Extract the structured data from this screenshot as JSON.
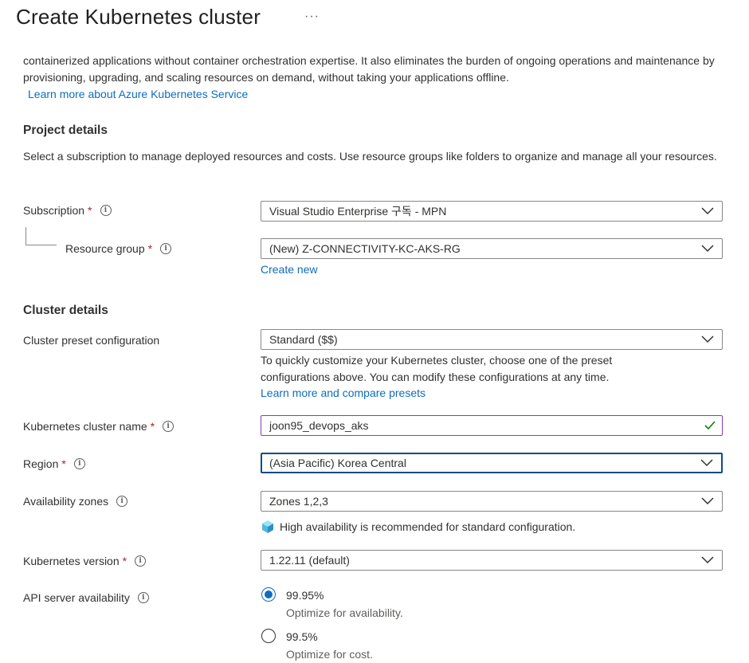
{
  "header": {
    "title": "Create Kubernetes cluster",
    "more": "···"
  },
  "intro": {
    "text": "containerized applications without container orchestration expertise. It also eliminates the burden of ongoing operations and maintenance by provisioning, upgrading, and scaling resources on demand, without taking your applications offline.",
    "link": "Learn more about Azure Kubernetes Service"
  },
  "project": {
    "heading": "Project details",
    "description": "Select a subscription to manage deployed resources and costs. Use resource groups like folders to organize and manage all your resources.",
    "subscription": {
      "label": "Subscription",
      "required": "*",
      "value": "Visual Studio Enterprise 구독 - MPN"
    },
    "resource_group": {
      "label": "Resource group",
      "required": "*",
      "value": "(New) Z-CONNECTIVITY-KC-AKS-RG",
      "create_new": "Create new"
    }
  },
  "cluster": {
    "heading": "Cluster details",
    "preset": {
      "label": "Cluster preset configuration",
      "value": "Standard ($$)",
      "help": "To quickly customize your Kubernetes cluster, choose one of the preset configurations above. You can modify these configurations at any time.",
      "link": "Learn more and compare presets"
    },
    "name": {
      "label": "Kubernetes cluster name",
      "required": "*",
      "value": "joon95_devops_aks"
    },
    "region": {
      "label": "Region",
      "required": "*",
      "value": "(Asia Pacific) Korea Central"
    },
    "zones": {
      "label": "Availability zones",
      "value": "Zones 1,2,3",
      "note": "High availability is recommended for standard configuration."
    },
    "version": {
      "label": "Kubernetes version",
      "required": "*",
      "value": "1.22.11 (default)"
    },
    "api": {
      "label": "API server availability",
      "options": [
        {
          "value": "99.95%",
          "sub": "Optimize for availability.",
          "selected": true
        },
        {
          "value": "99.5%",
          "sub": "Optimize for cost.",
          "selected": false
        }
      ]
    }
  },
  "colors": {
    "link": "#0f6cbd",
    "required": "#a4262c",
    "valid": "#107c10",
    "focus": "#0f4c81"
  },
  "icons": {
    "info": "info-icon",
    "dropdown": "chevron-down-icon",
    "valid": "checkmark-icon",
    "zones": "cube-icon"
  }
}
